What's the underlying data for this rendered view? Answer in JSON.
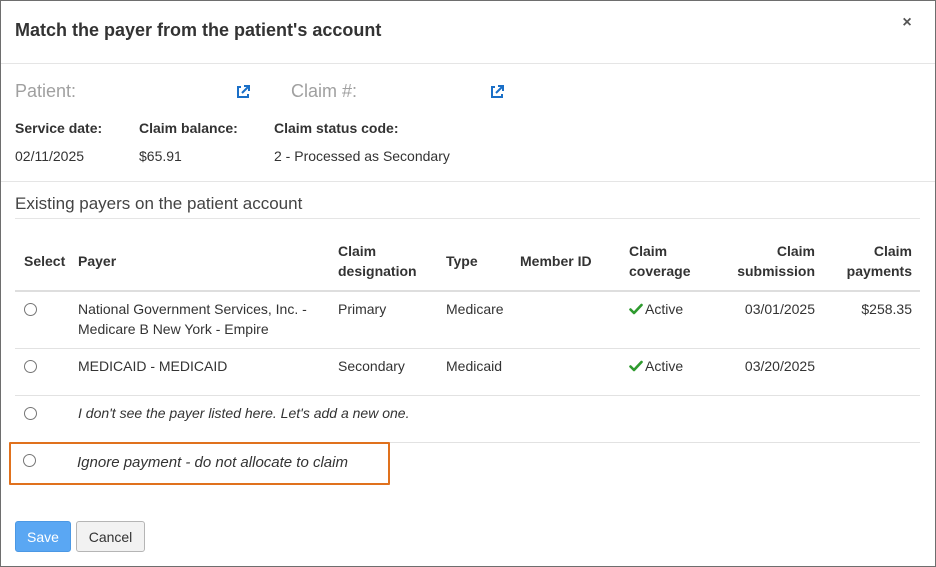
{
  "dialog": {
    "title": "Match the payer from the patient's account",
    "close_label": "×"
  },
  "info": {
    "patient_label": "Patient:",
    "claim_label": "Claim #:",
    "service_date_label": "Service date:",
    "service_date": "02/11/2025",
    "claim_balance_label": "Claim balance:",
    "claim_balance": "$65.91",
    "claim_status_label": "Claim status code:",
    "claim_status": "2 - Processed as Secondary"
  },
  "section": {
    "title": "Existing payers on the patient account"
  },
  "table": {
    "headers": {
      "select": "Select",
      "payer": "Payer",
      "designation_1": "Claim",
      "designation_2": "designation",
      "type": "Type",
      "member_id": "Member ID",
      "coverage_1": "Claim",
      "coverage_2": "coverage",
      "submission_1": "Claim",
      "submission_2": "submission",
      "payments_1": "Claim",
      "payments_2": "payments"
    },
    "rows": [
      {
        "payer_line1": "National Government Services, Inc. -",
        "payer_line2": "Medicare B New York - Empire",
        "designation": "Primary",
        "type": "Medicare",
        "member_id": "",
        "coverage": "Active",
        "submission": "03/01/2025",
        "payments": "$258.35"
      },
      {
        "payer_line1": "MEDICAID - MEDICAID",
        "payer_line2": "",
        "designation": "Secondary",
        "type": "Medicaid",
        "member_id": "",
        "coverage": "Active",
        "submission": "03/20/2025",
        "payments": ""
      }
    ],
    "add_new_label": "I don't see the payer listed here. Let's add a new one.",
    "ignore_label": "Ignore payment - do not allocate to claim"
  },
  "footer": {
    "save_label": "Save",
    "cancel_label": "Cancel"
  },
  "colors": {
    "accent": "#5aa7f3",
    "link_icon": "#1a6fc7",
    "check": "#2e9a2e",
    "highlight": "#e0711d"
  }
}
